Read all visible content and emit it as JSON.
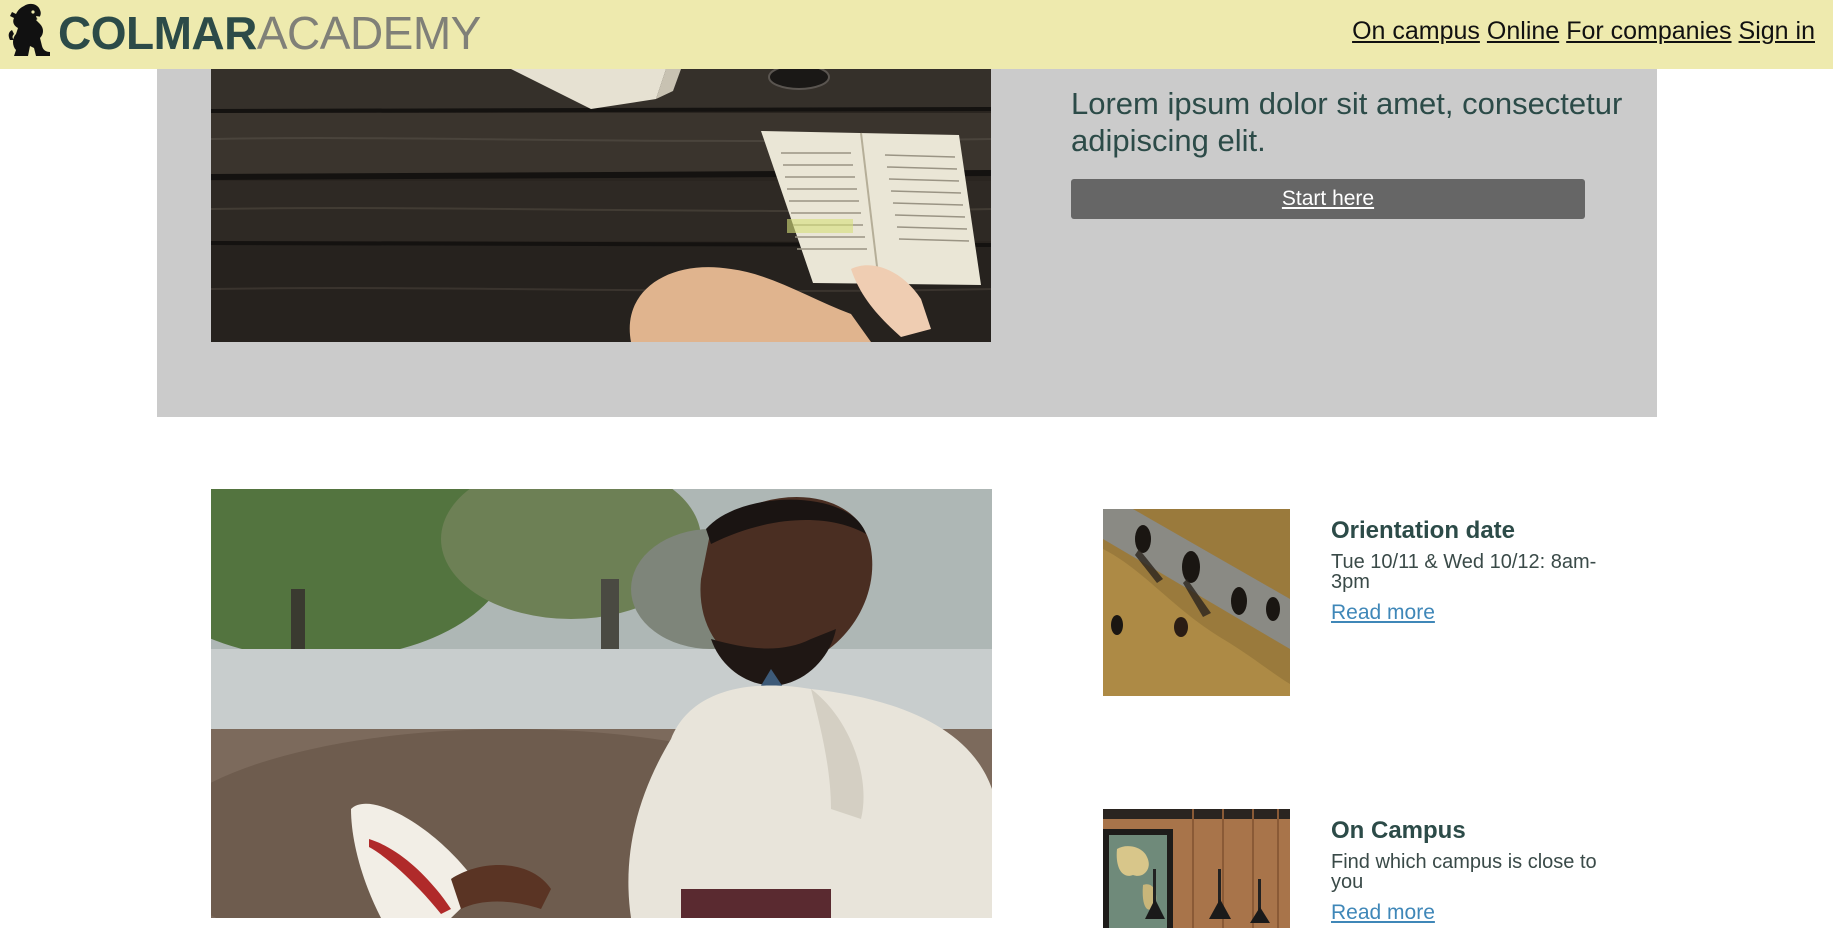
{
  "header": {
    "brand_bold": "COLMAR",
    "brand_light": "ACADEMY",
    "nav": [
      "On campus",
      "Online",
      "For companies",
      "Sign in"
    ]
  },
  "hero": {
    "text": "Lorem ipsum dolor sit amet, consectetur adipiscing elit.",
    "cta_label": "Start here"
  },
  "cards": [
    {
      "title": "Orientation date",
      "description": "Tue 10/11 & Wed 10/12: 8am-3pm",
      "link": "Read more"
    },
    {
      "title": "On Campus",
      "description": "Find which campus is close to you",
      "link": "Read more"
    }
  ],
  "colors": {
    "header_bg": "#eeeaae",
    "hero_bg": "#cbcbcb",
    "brand_dark": "#2c4b48",
    "brand_light": "#808078",
    "button_bg": "#666666",
    "link": "#3f87b8"
  },
  "icons": {
    "logo": "lion-rampant-icon"
  }
}
